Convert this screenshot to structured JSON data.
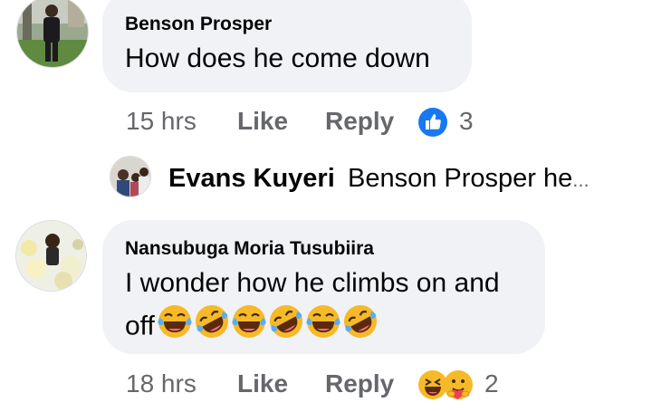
{
  "comments": [
    {
      "author": "Benson Prosper",
      "text": "How does he come down",
      "time": "15 hrs",
      "like_label": "Like",
      "reply_label": "Reply",
      "reactions": [
        "like-icon"
      ],
      "reaction_count": "3"
    },
    {
      "author": "Nansubuga Moria Tusubiira",
      "text_line1": "I wonder how he climbs on and",
      "text_line2": "off",
      "emojis": [
        "laughing-crying-emoji",
        "rolling-laughing-emoji",
        "laughing-crying-emoji",
        "rolling-laughing-emoji",
        "laughing-crying-emoji",
        "rolling-laughing-emoji"
      ],
      "time": "18 hrs",
      "like_label": "Like",
      "reply_label": "Reply",
      "reactions": [
        "haha-icon",
        "care-icon"
      ],
      "reaction_count": "2"
    }
  ],
  "reply_preview": {
    "author": "Evans Kuyeri",
    "text": "Benson Prosper he",
    "ellipsis": "..."
  },
  "colors": {
    "bubble": "#f0f2f5",
    "meta_text": "#65676b",
    "like_blue": "#1877f2",
    "emoji_yellow": "#f7b928"
  }
}
